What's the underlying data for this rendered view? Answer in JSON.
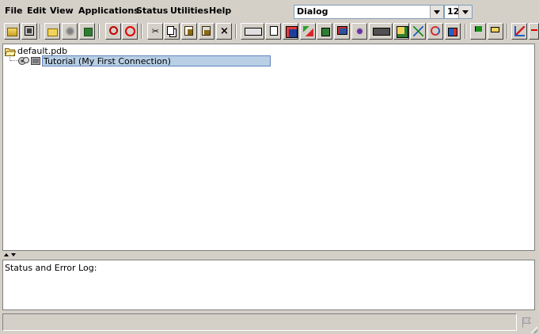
{
  "menu": [
    {
      "name": "menu-file",
      "label": "File"
    },
    {
      "name": "menu-edit",
      "label": "Edit"
    },
    {
      "name": "menu-view",
      "label": "View"
    },
    {
      "name": "menu-applications",
      "label": "Applications"
    },
    {
      "name": "menu-status",
      "label": "Status"
    },
    {
      "name": "menu-utilities",
      "label": "Utilities"
    },
    {
      "name": "menu-help",
      "label": "Help"
    }
  ],
  "font_combo": {
    "value": "Dialog"
  },
  "size_combo": {
    "value": "12"
  },
  "toolbar_icons": [
    "open-folder-icon",
    "save-icon",
    "new-folder-icon",
    "connection-settings-icon",
    "home-icon",
    "find-icon",
    "stop-icon",
    "cut-icon",
    "copy-icon",
    "paste-icon",
    "paste-special-icon",
    "delete-icon",
    "keyboard-icon",
    "document-gear-icon",
    "browser-icon",
    "tools-icon",
    "house-lock-icon",
    "monitor-icon",
    "gears-icon",
    "terminal-icon",
    "folder-refresh-icon",
    "network-icon",
    "refresh-icon",
    "lock-icon",
    "flag-icon",
    "signpost-icon",
    "chart-icon"
  ],
  "tree": {
    "root_label": "default.pdb",
    "child_label": "Tutorial (My First Connection)"
  },
  "log": {
    "label": "Status and Error Log:"
  },
  "status_bar": {
    "text": ""
  },
  "colors": {
    "background": "#d4d0c8",
    "selection": "#b8cfe5",
    "selection_border": "#6382bf"
  }
}
